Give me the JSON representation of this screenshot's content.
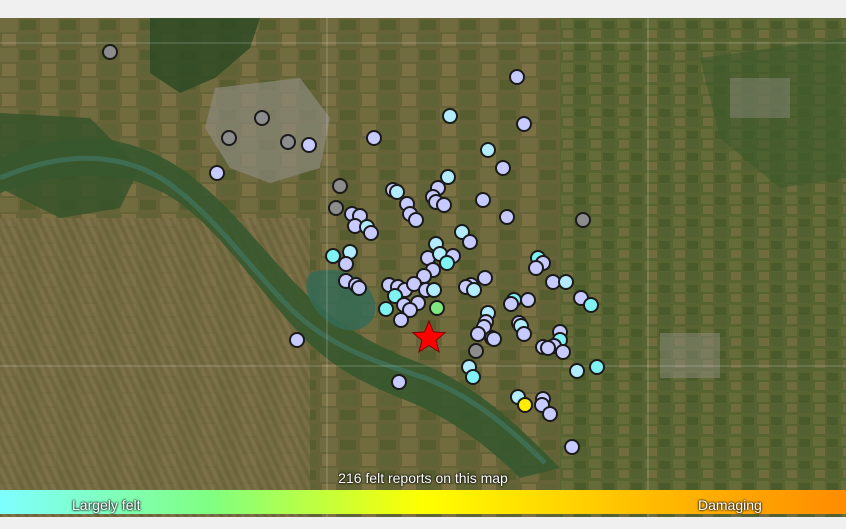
{
  "map": {
    "caption": "216 felt reports on this map",
    "legend": {
      "left_label": "Largely felt",
      "right_label": "Damaging",
      "gradient": [
        "#7fffff",
        "#80ff80",
        "#ffff00",
        "#ffc000",
        "#ff8c00"
      ]
    },
    "epicenter_icon": "star-icon",
    "colors": {
      "gray": "#8c8c8c",
      "lavender": "#c8cbff",
      "light_blue": "#b3ecff",
      "cyan": "#7ff3f3",
      "green": "#80e880",
      "yellow": "#ffee00",
      "epicenter": "#ff0000"
    }
  }
}
